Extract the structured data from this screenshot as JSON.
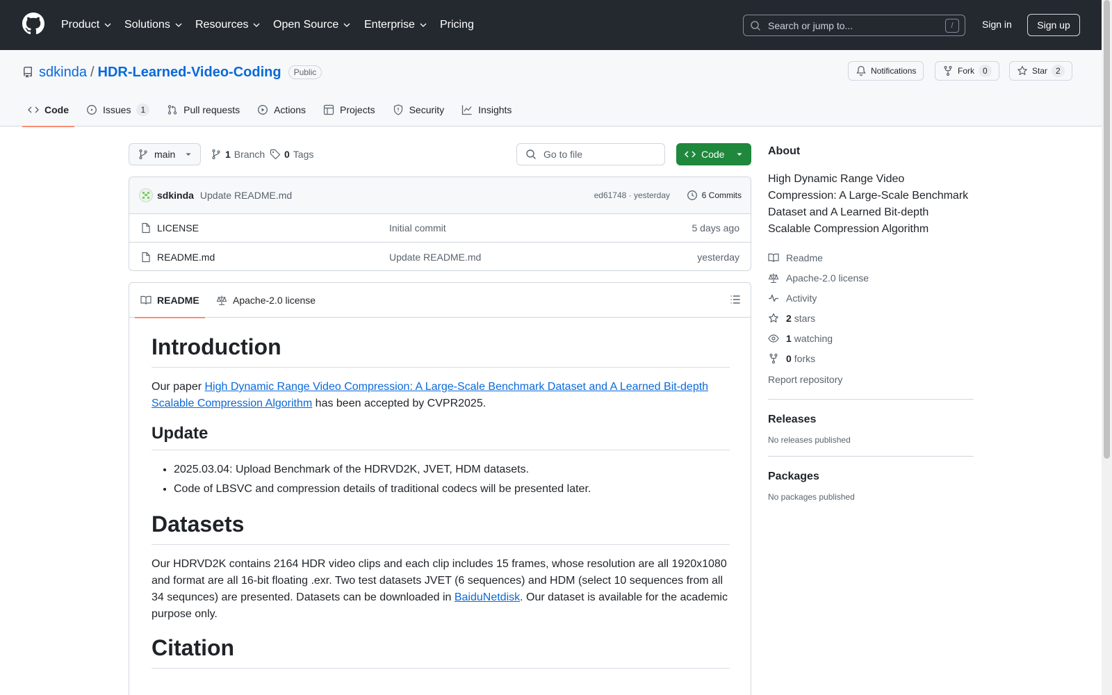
{
  "header": {
    "nav": [
      "Product",
      "Solutions",
      "Resources",
      "Open Source",
      "Enterprise",
      "Pricing"
    ],
    "search_placeholder": "Search or jump to...",
    "search_shortcut": "/",
    "sign_in": "Sign in",
    "sign_up": "Sign up"
  },
  "repo": {
    "owner": "sdkinda",
    "separator": "/",
    "name": "HDR-Learned-Video-Coding",
    "visibility": "Public",
    "notifications_label": "Notifications",
    "fork_label": "Fork",
    "fork_count": "0",
    "star_label": "Star",
    "star_count": "2",
    "tabs": [
      {
        "label": "Code",
        "count": ""
      },
      {
        "label": "Issues",
        "count": "1"
      },
      {
        "label": "Pull requests",
        "count": ""
      },
      {
        "label": "Actions",
        "count": ""
      },
      {
        "label": "Projects",
        "count": ""
      },
      {
        "label": "Security",
        "count": ""
      },
      {
        "label": "Insights",
        "count": ""
      }
    ]
  },
  "filenav": {
    "branch": "main",
    "branches_count": "1",
    "branches_label": "Branch",
    "tags_count": "0",
    "tags_label": "Tags",
    "goto_placeholder": "Go to file",
    "code_label": "Code"
  },
  "commit": {
    "author": "sdkinda",
    "message": "Update README.md",
    "sha_time": "ed61748 · yesterday",
    "commits_label": "6 Commits"
  },
  "files": [
    {
      "name": "LICENSE",
      "message": "Initial commit",
      "time": "5 days ago"
    },
    {
      "name": "README.md",
      "message": "Update README.md",
      "time": "yesterday"
    }
  ],
  "readme": {
    "tab_readme": "README",
    "tab_license": "Apache-2.0 license",
    "h_intro": "Introduction",
    "intro_pre": "Our paper ",
    "intro_link": "High Dynamic Range Video Compression: A Large-Scale Benchmark Dataset and A Learned Bit-depth Scalable Compression Algorithm",
    "intro_post": " has been accepted by CVPR2025.",
    "h_update": "Update",
    "updates": [
      "2025.03.04: Upload Benchmark of the HDRVD2K, JVET, HDM datasets.",
      "Code of LBSVC and compression details of traditional codecs will be presented later."
    ],
    "h_datasets": "Datasets",
    "datasets_pre": "Our HDRVD2K contains 2164 HDR video clips and each clip includes 15 frames, whose resolution are all 1920x1080 and format are all 16-bit floating .exr. Two test datasets JVET (6 sequences) and HDM (select 10 sequences from all 34 sequnces) are presented. Datasets can be downloaded in ",
    "datasets_link": "BaiduNetdisk",
    "datasets_post": ". Our dataset is available for the academic purpose only.",
    "h_citation": "Citation"
  },
  "about": {
    "title": "About",
    "description": "High Dynamic Range Video Compression: A Large-Scale Benchmark Dataset and A Learned Bit-depth Scalable Compression Algorithm",
    "readme": "Readme",
    "license": "Apache-2.0 license",
    "activity": "Activity",
    "stars_count": "2",
    "stars_label": "stars",
    "watching_count": "1",
    "watching_label": "watching",
    "forks_count": "0",
    "forks_label": "forks",
    "report": "Report repository"
  },
  "releases": {
    "title": "Releases",
    "note": "No releases published"
  },
  "packages": {
    "title": "Packages",
    "note": "No packages published"
  },
  "colors": {
    "header_bg": "#24292f",
    "link": "#0969da",
    "green": "#1f883d",
    "tab_underline": "#fd8c73"
  }
}
